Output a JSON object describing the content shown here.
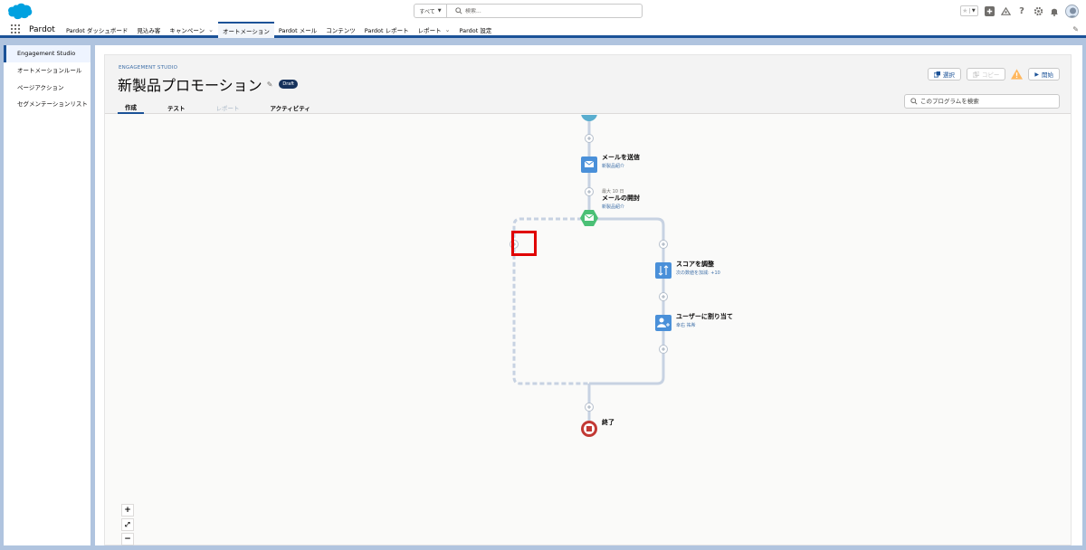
{
  "header": {
    "search_scope": "すべて",
    "search_placeholder": "検索..."
  },
  "nav": {
    "app_name": "Pardot",
    "items": [
      {
        "label": "Pardot ダッシュボード",
        "has_menu": false
      },
      {
        "label": "見込み客",
        "has_menu": false
      },
      {
        "label": "キャンペーン",
        "has_menu": true
      },
      {
        "label": "オートメーション",
        "has_menu": false,
        "active": true
      },
      {
        "label": "Pardot メール",
        "has_menu": false
      },
      {
        "label": "コンテンツ",
        "has_menu": false
      },
      {
        "label": "Pardot レポート",
        "has_menu": false
      },
      {
        "label": "レポート",
        "has_menu": true
      },
      {
        "label": "Pardot 設定",
        "has_menu": false
      }
    ]
  },
  "sidebar": {
    "items": [
      {
        "label": "Engagement Studio",
        "active": true
      },
      {
        "label": "オートメーションルール"
      },
      {
        "label": "ページアクション"
      },
      {
        "label": "セグメンテーションリスト"
      }
    ]
  },
  "program": {
    "eyebrow": "ENGAGEMENT STUDIO",
    "title": "新製品プロモーション",
    "status": "Draft",
    "tabs": [
      {
        "label": "作成",
        "active": true
      },
      {
        "label": "テスト"
      },
      {
        "label": "レポート",
        "disabled": true
      },
      {
        "label": "アクティビティ"
      }
    ],
    "buttons": {
      "select": "選択",
      "copy": "コピー",
      "start": "開始"
    },
    "search_placeholder": "このプログラムを検索"
  },
  "canvas": {
    "nodes": {
      "send_email": {
        "label": "メールを送信",
        "sub": "新製品紹介"
      },
      "email_open": {
        "pre": "最大 10 日",
        "label": "メールの開封",
        "sub": "新製品紹介"
      },
      "adjust_score": {
        "label": "スコアを調整",
        "sub": "次の数値を加減: +10"
      },
      "assign_user": {
        "label": "ユーザーに割り当て",
        "sub": "幸右 祐希"
      },
      "end": {
        "label": "終了"
      }
    },
    "zoom": {
      "in": "+",
      "fit": "⤢",
      "out": "−"
    }
  },
  "colors": {
    "brand": "#1b5297",
    "email_node": "#4a90d9",
    "trigger_node": "#4bc076",
    "end_node": "#c23934",
    "highlight": "#e00000"
  }
}
